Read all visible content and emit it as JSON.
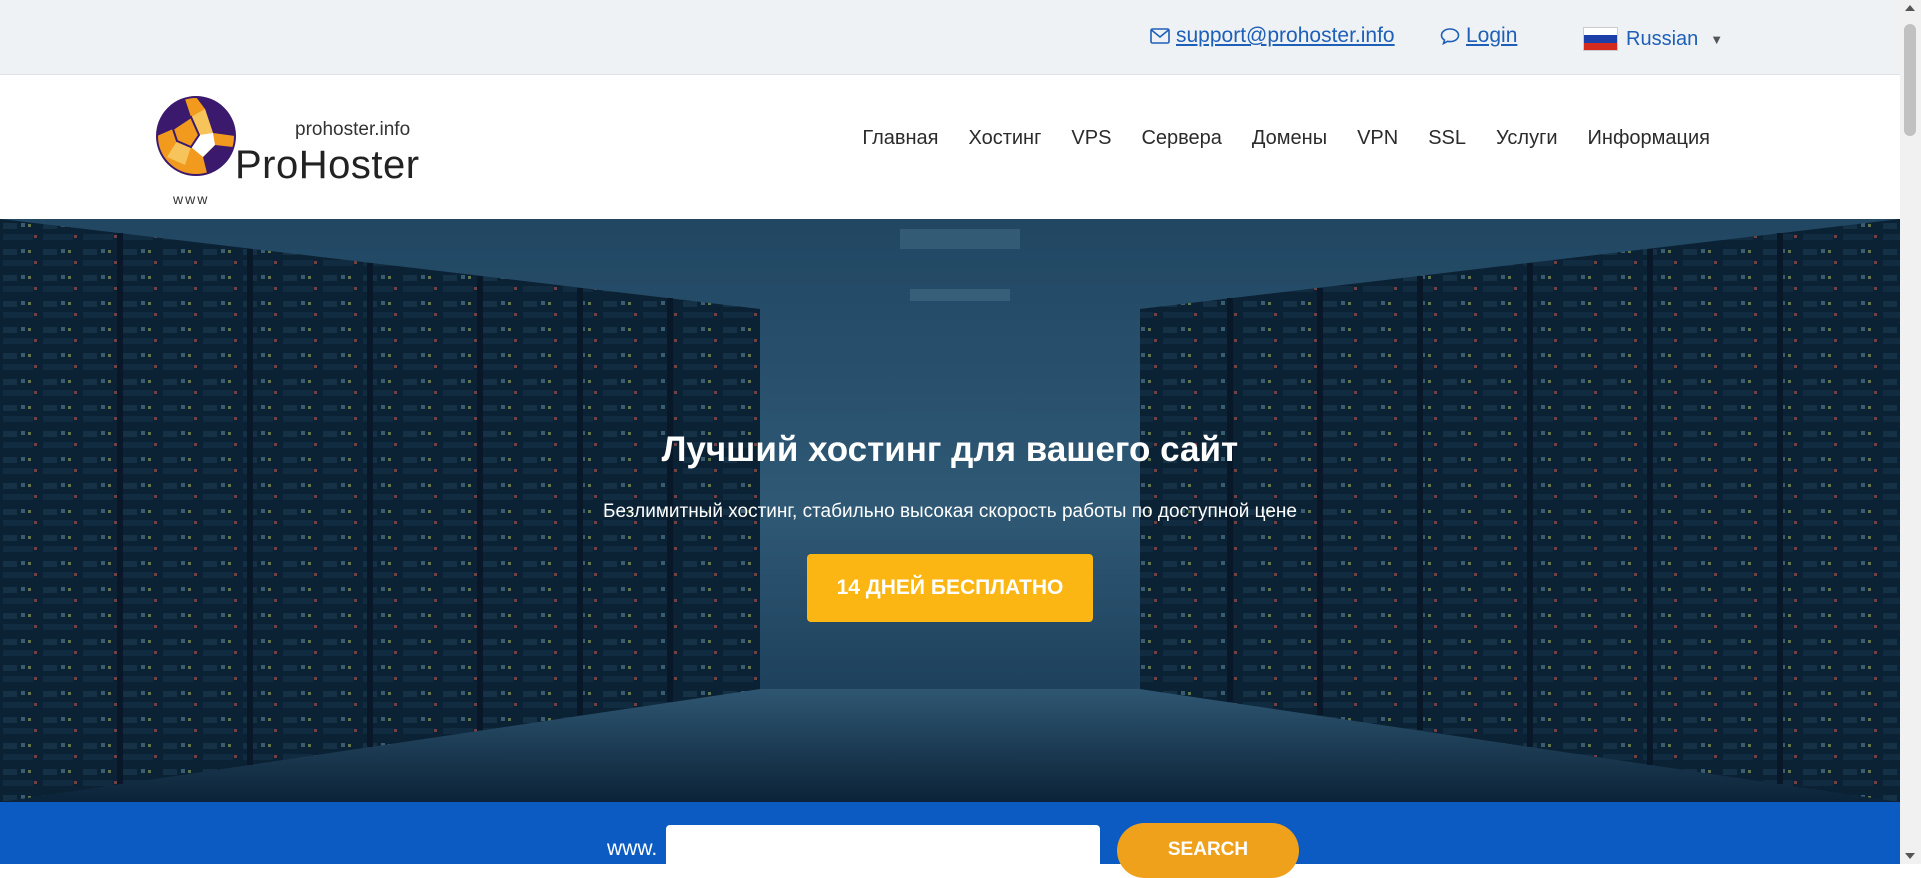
{
  "topbar": {
    "email": "support@prohoster.info ",
    "login": "Login",
    "language": "Russian"
  },
  "logo": {
    "domain": "prohoster.info",
    "brand": "ProHoster",
    "www": "www"
  },
  "nav": [
    "Главная",
    "Хостинг",
    "VPS",
    "Сервера",
    "Домены",
    "VPN",
    "SSL",
    "Услуги",
    "Информация"
  ],
  "hero": {
    "title": "Лучший хостинг для вашего сайт",
    "subtitle": "Безлимитный хостинг, стабильно высокая скорость работы по доступной цене",
    "cta": "14 ДНЕЙ БЕСПЛАТНО"
  },
  "search": {
    "prefix": "www.",
    "value": "",
    "button": "SEARCH"
  },
  "colors": {
    "topbar_bg": "#eef2f5",
    "link": "#1e5fb8",
    "cta": "#fbb613",
    "search_bar": "#0b5bc3",
    "search_button": "#f0a11b",
    "hero_bg": "#0e2a44"
  },
  "icons": {
    "email": "envelope-icon",
    "login": "speech-bubble-icon",
    "language": "russia-flag-icon",
    "dropdown": "caret-down-icon"
  }
}
